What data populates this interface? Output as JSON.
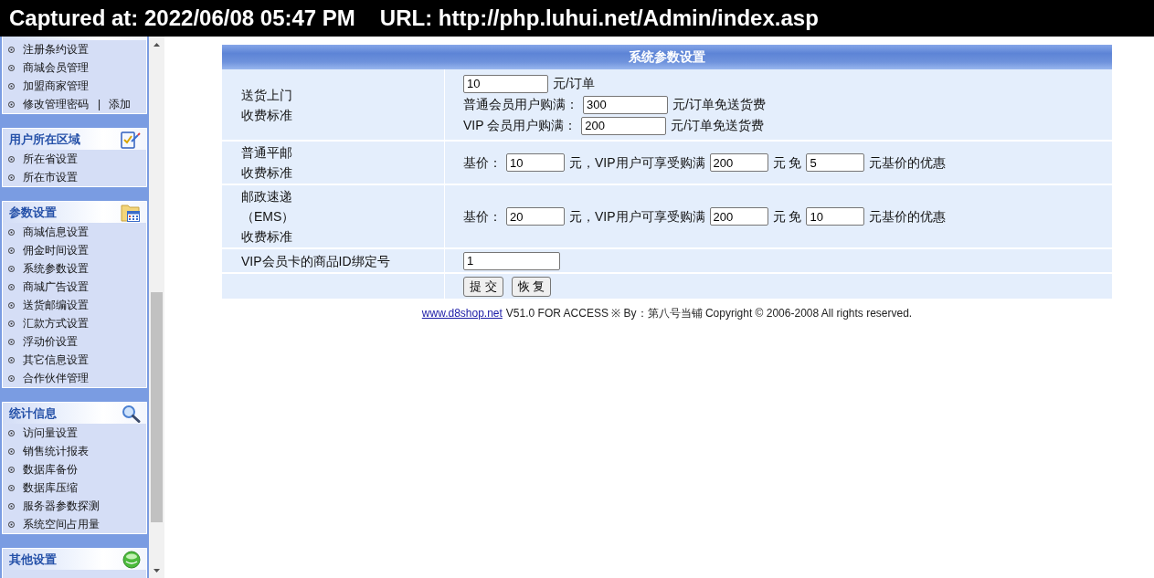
{
  "capture_bar": {
    "captured": "Captured at: 2022/06/08 05:47 PM",
    "url": "URL: http://php.luhui.net/Admin/index.asp"
  },
  "sidebar": {
    "panels": [
      {
        "items": [
          {
            "label": "注册条约设置"
          },
          {
            "label": "商城会员管理"
          },
          {
            "label": "加盟商家管理"
          },
          {
            "label": "修改管理密码",
            "separator": "|",
            "extra": "添加"
          }
        ]
      },
      {
        "title": "用户所在区域",
        "items": [
          {
            "label": "所在省设置"
          },
          {
            "label": "所在市设置"
          }
        ]
      },
      {
        "title": "参数设置",
        "items": [
          {
            "label": "商城信息设置"
          },
          {
            "label": "佣金时间设置"
          },
          {
            "label": "系统参数设置"
          },
          {
            "label": "商城广告设置"
          },
          {
            "label": "送货邮编设置"
          },
          {
            "label": "汇款方式设置"
          },
          {
            "label": "浮动价设置"
          },
          {
            "label": "其它信息设置"
          },
          {
            "label": "合作伙伴管理"
          }
        ]
      },
      {
        "title": "统计信息",
        "items": [
          {
            "label": "访问量设置"
          },
          {
            "label": "销售统计报表"
          },
          {
            "label": "数据库备份"
          },
          {
            "label": "数据库压缩"
          },
          {
            "label": "服务器参数探测"
          },
          {
            "label": "系统空间占用量"
          }
        ]
      },
      {
        "title": "其他设置"
      }
    ]
  },
  "form": {
    "title": "系统参数设置",
    "rows": [
      {
        "kind": "stacked",
        "label": [
          "送货上门",
          "收费标准"
        ],
        "lines": [
          [
            {
              "kind": "field",
              "value": "10"
            },
            {
              "kind": "text",
              "text": "元/订单"
            }
          ],
          [
            {
              "kind": "text",
              "text": "普通会员用户购满："
            },
            {
              "kind": "field",
              "value": "300"
            },
            {
              "kind": "text",
              "text": "元/订单免送货费"
            }
          ],
          [
            {
              "kind": "text",
              "text": "VIP 会员用户购满："
            },
            {
              "kind": "field",
              "value": "200"
            },
            {
              "kind": "text",
              "text": "元/订单免送货费"
            }
          ]
        ]
      },
      {
        "kind": "inline",
        "label": [
          "普通平邮",
          "收费标准"
        ],
        "lines": [
          [
            {
              "kind": "text",
              "text": "基价："
            },
            {
              "kind": "field",
              "value": "10"
            },
            {
              "kind": "text",
              "text": "元，VIP用户可享受购满"
            },
            {
              "kind": "field",
              "value": "200"
            },
            {
              "kind": "text",
              "text": "元 免"
            },
            {
              "kind": "field",
              "value": "5"
            },
            {
              "kind": "text",
              "text": "元基价的优惠"
            }
          ]
        ]
      },
      {
        "kind": "inline",
        "label": [
          "邮政速递",
          "（EMS）",
          "收费标准"
        ],
        "lines": [
          [
            {
              "kind": "text",
              "text": "基价："
            },
            {
              "kind": "field",
              "value": "20"
            },
            {
              "kind": "text",
              "text": "元，VIP用户可享受购满"
            },
            {
              "kind": "field",
              "value": "200"
            },
            {
              "kind": "text",
              "text": "元 免"
            },
            {
              "kind": "field",
              "value": "10"
            },
            {
              "kind": "text",
              "text": "元基价的优惠"
            }
          ]
        ]
      },
      {
        "kind": "single",
        "label": [
          "VIP会员卡的商品ID绑定号"
        ],
        "lines": [
          [
            {
              "kind": "field",
              "value": "1"
            }
          ]
        ]
      },
      {
        "kind": "actions",
        "lines": [
          [
            {
              "kind": "button",
              "text": "提 交"
            },
            {
              "kind": "button",
              "text": "恢 复"
            }
          ]
        ]
      }
    ]
  },
  "footer": {
    "link": "www.d8shop.net",
    "text": "V51.0 FOR ACCESS ※ By：第八号当铺 Copyright © 2006-2008 All rights reserved."
  }
}
